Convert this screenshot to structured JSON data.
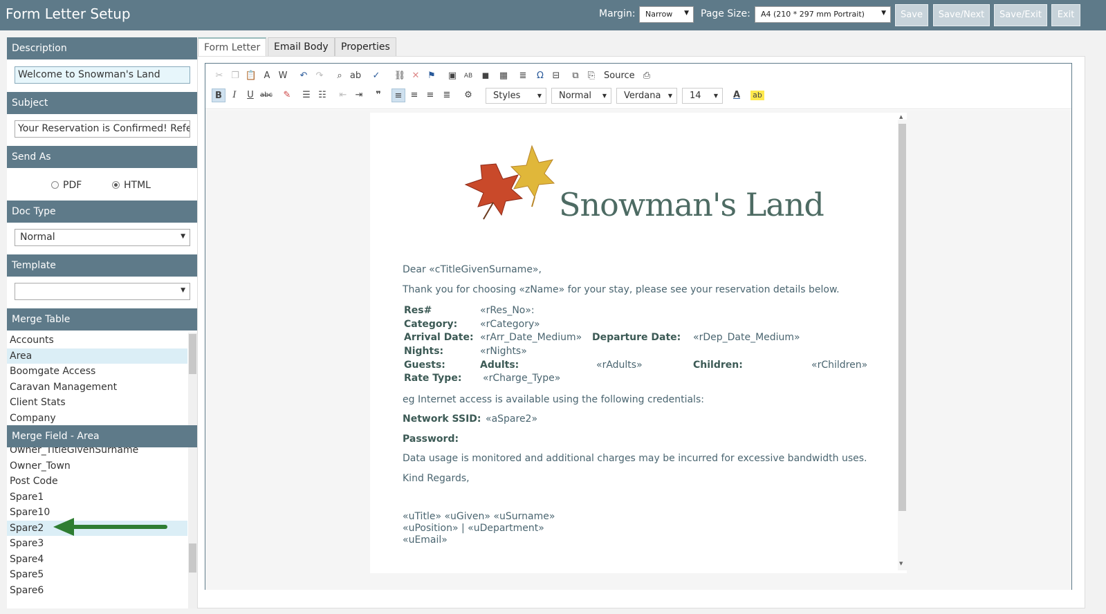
{
  "header": {
    "title": "Form Letter Setup",
    "margin_label": "Margin:",
    "margin_value": "Narrow",
    "page_size_label": "Page Size:",
    "page_size_value": "A4 (210 * 297 mm Portrait)",
    "buttons": {
      "save": "Save",
      "save_next": "Save/Next",
      "save_exit": "Save/Exit",
      "exit": "Exit"
    }
  },
  "sidebar": {
    "description": {
      "label": "Description",
      "value": "Welcome to Snowman's Land"
    },
    "subject": {
      "label": "Subject",
      "value": "Your Reservation is Confirmed! Refe"
    },
    "send_as": {
      "label": "Send As",
      "options": [
        "PDF",
        "HTML"
      ],
      "selected": "HTML"
    },
    "doc_type": {
      "label": "Doc Type",
      "value": "Normal"
    },
    "template": {
      "label": "Template",
      "value": ""
    },
    "merge_table": {
      "label": "Merge Table",
      "items": [
        "Accounts",
        "Area",
        "Boomgate Access",
        "Caravan Management",
        "Client Stats",
        "Company"
      ],
      "selected": "Area"
    },
    "merge_field": {
      "label": "Merge Field - Area",
      "items": [
        "Owner_TitleGivenSurname",
        "Owner_Town",
        "Post Code",
        "Spare1",
        "Spare10",
        "Spare2",
        "Spare3",
        "Spare4",
        "Spare5",
        "Spare6"
      ],
      "selected": "Spare2"
    }
  },
  "tabs": [
    "Form Letter",
    "Email Body",
    "Properties"
  ],
  "toolbar": {
    "source_label": "Source",
    "styles": "Styles",
    "format": "Normal",
    "font": "Verdana",
    "size": "14"
  },
  "document": {
    "brand": "Snowman's Land",
    "greeting": "Dear «cTitleGivenSurname»,",
    "intro": "Thank you for choosing «zName» for your stay, please see your reservation details below.",
    "details": {
      "res_label": "Res#",
      "res_value": "«rRes_No»:",
      "category_label": "Category:",
      "category_value": "«rCategory»",
      "arrival_label": "Arrival Date:",
      "arrival_value": "«rArr_Date_Medium»",
      "departure_label": "Departure Date:",
      "departure_value": "«rDep_Date_Medium»",
      "nights_label": "Nights:",
      "nights_value": "«rNights»",
      "guests_label": "Guests:",
      "adults_label": "Adults:",
      "adults_value": "«rAdults»",
      "children_label": "Children:",
      "children_value": "«rChildren»",
      "rate_label": "Rate Type:",
      "rate_value": "«rCharge_Type»"
    },
    "internet_note": "eg Internet access is available using the following credentials:",
    "ssid_label": "Network SSID:",
    "ssid_value": "«aSpare2»",
    "password_label": "Password:",
    "usage_note": "Data usage is monitored and additional charges may be incurred for excessive bandwidth uses.",
    "closing": "Kind Regards,",
    "sig_line1": "«uTitle» «uGiven» «uSurname»",
    "sig_line2": "«uPosition» | «uDepartment»",
    "sig_line3": "«uEmail»"
  },
  "colors": {
    "header_bg": "#5e7a89",
    "button_bg": "#c7d3da",
    "brand_text": "#4d6b63",
    "arrow": "#2e7d32",
    "selection": "#dbeef6"
  }
}
